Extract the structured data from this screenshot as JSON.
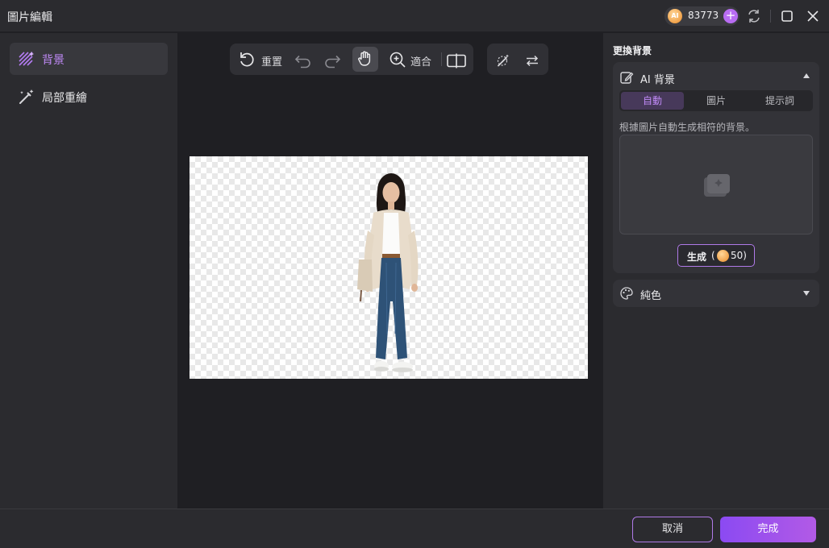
{
  "window": {
    "title": "圖片編輯"
  },
  "credits": {
    "badge_text": "AI",
    "count": "83773",
    "add_label": "+"
  },
  "sidebar": {
    "items": [
      {
        "label": "背景",
        "icon": "background-pattern-icon",
        "active": true
      },
      {
        "label": "局部重繪",
        "icon": "magic-wand-icon",
        "active": false
      }
    ]
  },
  "toolbar": {
    "reset_label": "重置",
    "fit_label": "適合"
  },
  "right_panel": {
    "title": "更換背景",
    "ai_section": {
      "label": "AI 背景",
      "tabs": [
        "自動",
        "圖片",
        "提示詞"
      ],
      "active_tab": "自動",
      "hint": "根據圖片自動生成相符的背景。",
      "generate_label": "生成",
      "paren_open": "(",
      "cost": "50)"
    },
    "solid_section": {
      "label": "純色"
    }
  },
  "footer": {
    "cancel_label": "取消",
    "done_label": "完成"
  },
  "colors": {
    "accent": "#b07ae8",
    "accent_text": "#c08af7",
    "done_gradient_start": "#8b4af2",
    "done_gradient_end": "#b25ae6"
  }
}
